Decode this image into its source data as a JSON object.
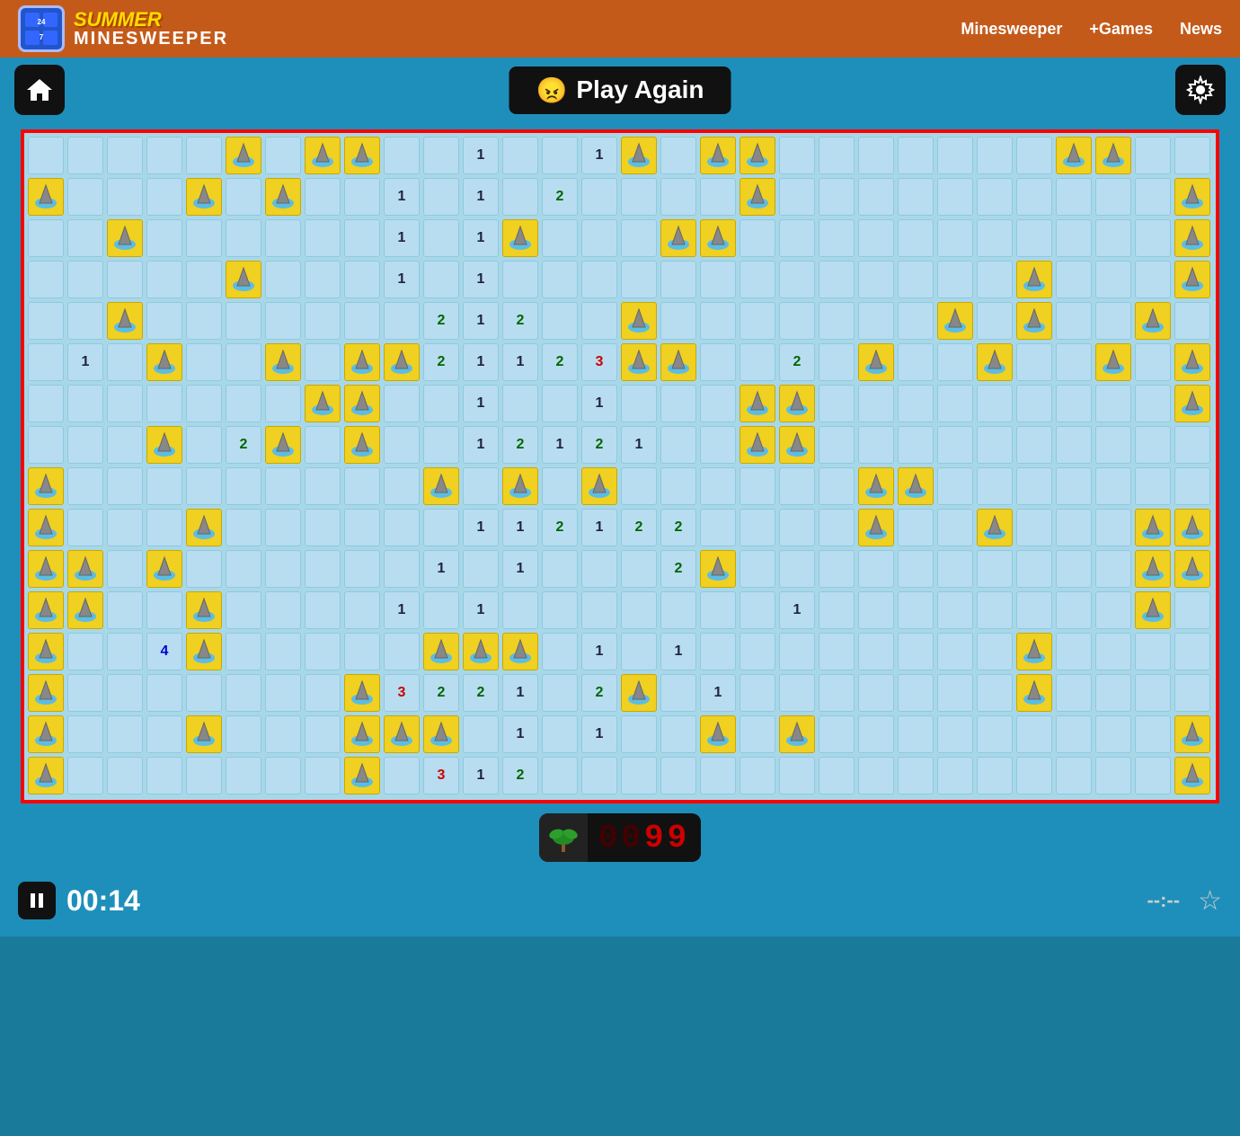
{
  "header": {
    "logo_summer": "SUMMER",
    "logo_minesweeper": "MINESWEEPER",
    "nav": {
      "minesweeper": "Minesweeper",
      "games": "+Games",
      "news": "News"
    }
  },
  "toolbar": {
    "play_again": "Play Again"
  },
  "status": {
    "time": "00:14",
    "mine_count": "99",
    "score_dashes": "--:--"
  },
  "board": {
    "cols": 30,
    "rows": 16
  }
}
